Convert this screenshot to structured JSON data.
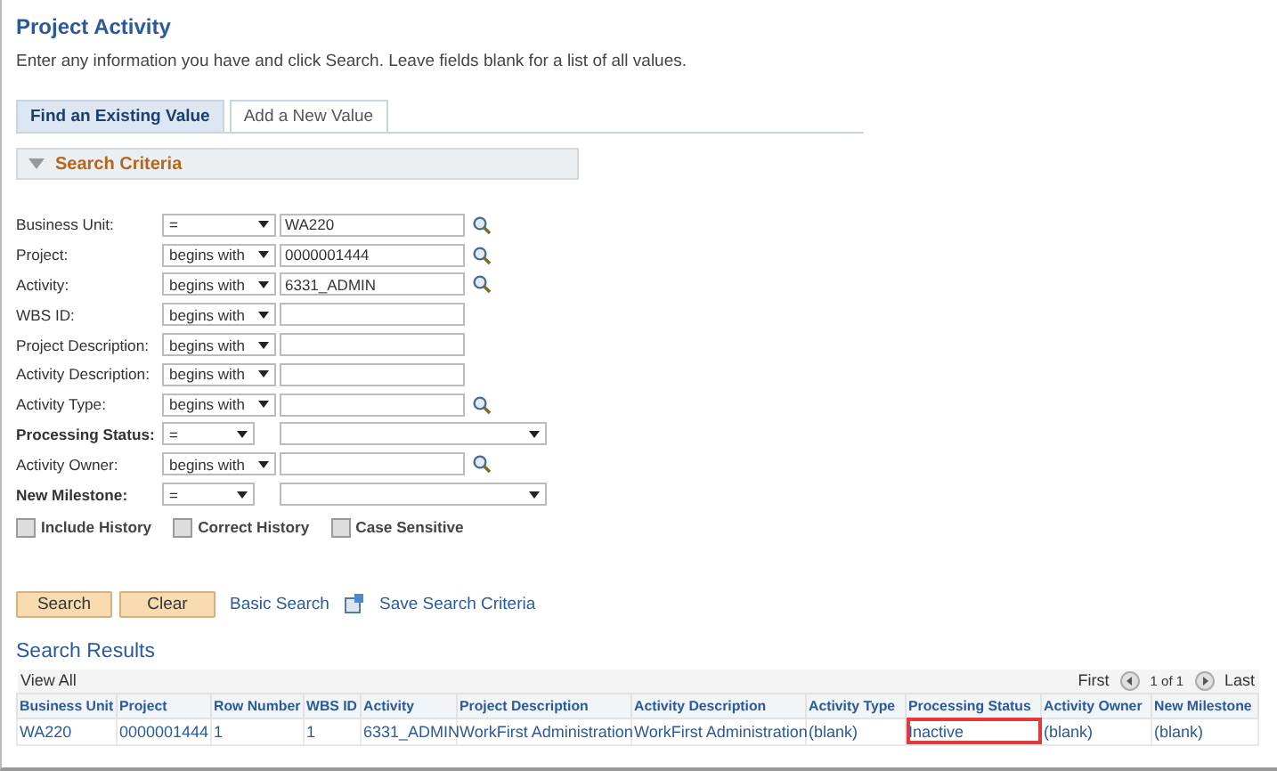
{
  "page": {
    "title": "Project Activity",
    "instructions": "Enter any information you have and click Search. Leave fields blank for a list of all values."
  },
  "tabs": [
    {
      "label": "Find an Existing Value",
      "selected": true
    },
    {
      "label": "Add a New Value",
      "selected": false
    }
  ],
  "section": {
    "title": "Search Criteria",
    "expanded": true
  },
  "fields": [
    {
      "label": "Business Unit:",
      "bold": false,
      "kind": "lookup",
      "operator": "=",
      "value": "WA220"
    },
    {
      "label": "Project:",
      "bold": false,
      "kind": "lookup",
      "operator": "begins with",
      "value": "0000001444"
    },
    {
      "label": "Activity:",
      "bold": false,
      "kind": "lookup",
      "operator": "begins with",
      "value": "6331_ADMIN"
    },
    {
      "label": "WBS ID:",
      "bold": false,
      "kind": "text",
      "operator": "begins with"
    },
    {
      "label": "Project Description:",
      "bold": false,
      "kind": "text",
      "operator": "begins with"
    },
    {
      "label": "Activity Description:",
      "bold": false,
      "kind": "text",
      "operator": "begins with"
    },
    {
      "label": "Activity Type:",
      "bold": false,
      "kind": "lookup",
      "operator": "begins with"
    },
    {
      "label": "Processing Status:",
      "bold": true,
      "kind": "select",
      "operator": "="
    },
    {
      "label": "Activity Owner:",
      "bold": false,
      "kind": "lookup",
      "operator": "begins with"
    },
    {
      "label": "New Milestone:",
      "bold": true,
      "kind": "select",
      "operator": "="
    }
  ],
  "options": [
    {
      "label": "Include History",
      "checked": false
    },
    {
      "label": "Correct History",
      "checked": false
    },
    {
      "label": "Case Sensitive",
      "checked": false
    }
  ],
  "buttons": [
    "Search",
    "Clear"
  ],
  "links": {
    "basic_search": "Basic Search",
    "save_criteria": "Save Search Criteria"
  },
  "results": {
    "title": "Search Results",
    "view_all": "View All",
    "first": "First",
    "page_count": "1 of 1",
    "last": "Last",
    "columns": [
      "Business Unit",
      "Project",
      "Row Number",
      "WBS ID",
      "Activity",
      "Project Description",
      "Activity Description",
      "Activity Type",
      "Processing Status",
      "Activity Owner",
      "New Milestone"
    ],
    "rows": [
      {
        "cells": [
          {
            "text": "WA220",
            "highlighted": false
          },
          {
            "text": "0000001444",
            "highlighted": false
          },
          {
            "text": "1",
            "highlighted": false
          },
          {
            "text": "1",
            "highlighted": false
          },
          {
            "text": "6331_ADMIN",
            "highlighted": false
          },
          {
            "text": "WorkFirst Administration",
            "highlighted": false
          },
          {
            "text": "WorkFirst Administration",
            "highlighted": false
          },
          {
            "text": "(blank)",
            "highlighted": false
          },
          {
            "text": "Inactive",
            "highlighted": true
          },
          {
            "text": "(blank)",
            "highlighted": false
          },
          {
            "text": "(blank)",
            "highlighted": false
          }
        ]
      }
    ]
  }
}
